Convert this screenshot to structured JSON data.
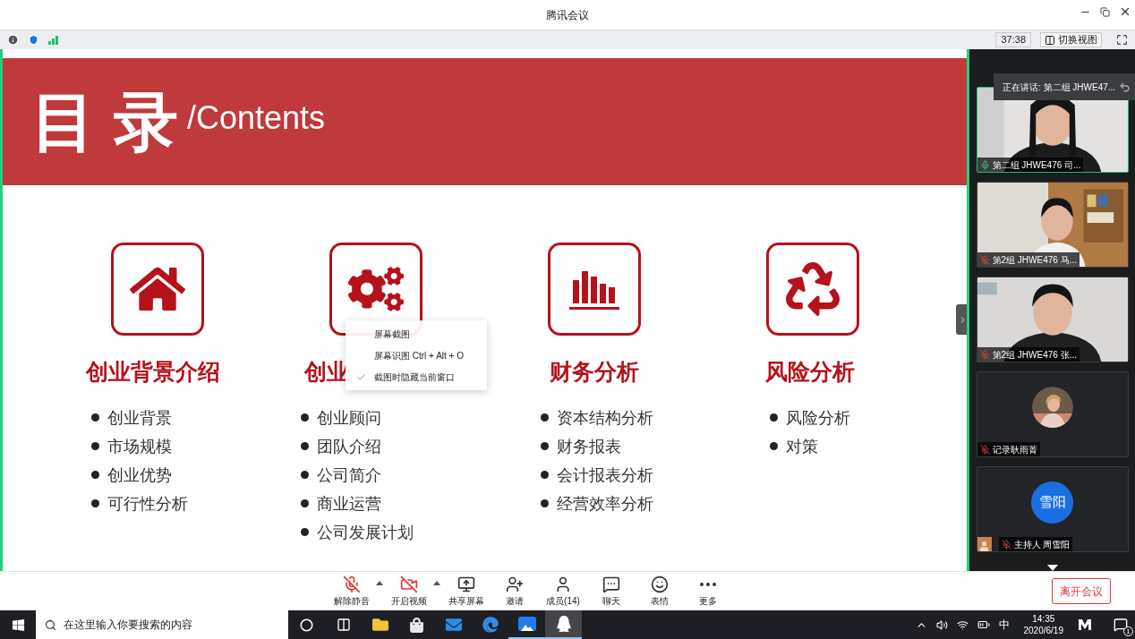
{
  "window": {
    "title": "腾讯会议"
  },
  "info_bar": {
    "timer": "37:38",
    "switch_view": "切换视图"
  },
  "slide": {
    "title": "目 录",
    "subtitle": "/Contents",
    "columns": [
      {
        "kind": "house",
        "heading": "创业背景介绍",
        "items": [
          "创业背景",
          "市场规模",
          "创业优势",
          "可行性分析"
        ]
      },
      {
        "kind": "gears",
        "heading": "创业",
        "items": [
          "创业顾问",
          "团队介绍",
          "公司简介",
          "商业运营",
          "公司发展计划"
        ]
      },
      {
        "kind": "chart",
        "heading": "财务分析",
        "items": [
          "资本结构分析",
          "财务报表",
          "会计报表分析",
          "经营效率分析"
        ]
      },
      {
        "kind": "recycle",
        "heading": "风险分析",
        "items": [
          "风险分析",
          "对策"
        ]
      }
    ]
  },
  "context_menu": [
    {
      "label": "屏幕截图",
      "checked": false
    },
    {
      "label": "屏幕识图 Ctrl + Alt + O",
      "checked": false
    },
    {
      "label": "截图时隐藏当前窗口",
      "checked": true
    }
  ],
  "speaker_banner": "正在讲话: 第二组 JHWE47...",
  "participants": [
    {
      "kind": "video",
      "name": "第二组 JHWE476 司...",
      "muted": false,
      "speaking": true
    },
    {
      "kind": "video",
      "name": "第2组 JHWE476 马...",
      "muted": true,
      "speaking": false
    },
    {
      "kind": "video",
      "name": "第2组 JHWE476 张...",
      "muted": true,
      "speaking": false
    },
    {
      "name": "记录耿雨菁",
      "muted": true,
      "speaking": false
    },
    {
      "kind": "initials",
      "initials": "雪阳",
      "name": "主持人 周雪阳",
      "muted": true,
      "speaking": false
    }
  ],
  "toolbar": [
    {
      "kind": "mic",
      "label": "解除静音",
      "menu": true
    },
    {
      "kind": "video",
      "label": "开启视频",
      "menu": true
    },
    {
      "kind": "share",
      "label": "共享屏幕",
      "menu": false
    },
    {
      "kind": "invite",
      "label": "邀请",
      "menu": false
    },
    {
      "kind": "members",
      "label": "成员(14)",
      "menu": false
    },
    {
      "kind": "chat",
      "label": "聊天",
      "menu": false
    },
    {
      "kind": "emoji",
      "label": "表情",
      "menu": false
    },
    {
      "kind": "more",
      "label": "更多",
      "menu": false
    }
  ],
  "leave_button": "离开会议",
  "taskbar": {
    "search_placeholder": "在这里输入你要搜索的内容",
    "apps": [
      {
        "kind": "cortana",
        "running": false,
        "selected": false
      },
      {
        "kind": "taskview",
        "running": false,
        "selected": false
      },
      {
        "kind": "folder",
        "running": false,
        "selected": false
      },
      {
        "kind": "store",
        "running": false,
        "selected": false
      },
      {
        "kind": "mail",
        "running": false,
        "selected": false
      },
      {
        "kind": "edge",
        "running": false,
        "selected": false
      },
      {
        "kind": "meeting",
        "running": true,
        "selected": false
      },
      {
        "kind": "qq",
        "running": true,
        "selected": true
      }
    ],
    "ime": "中",
    "time": "14:35",
    "date": "2020/6/19",
    "notifications": "1"
  }
}
